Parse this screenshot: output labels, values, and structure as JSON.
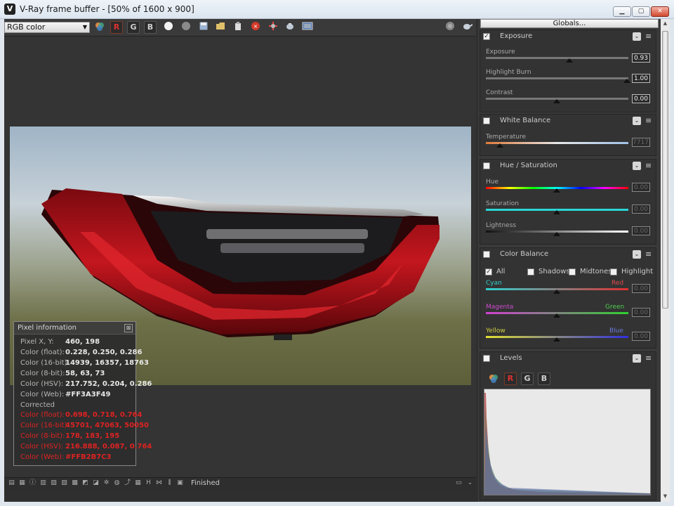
{
  "window": {
    "title": "V-Ray frame buffer - [50% of 1600 x 900]",
    "app_icon": "V",
    "minimize_icon": "minimize-icon",
    "maximize_icon": "maximize-icon",
    "close_icon": "close-icon"
  },
  "toolbar": {
    "channel": "RGB color",
    "r_label": "R",
    "g_label": "G",
    "b_label": "B",
    "icons": [
      "color-corrections-icon",
      "white-dot-icon",
      "gray-dot-icon",
      "save-icon",
      "open-icon",
      "clear-icon",
      "stop-icon",
      "region-icon",
      "teapot-icon",
      "camera-icon",
      "render-icon",
      "teapot-right-icon"
    ]
  },
  "pixel_info": {
    "title": "Pixel information",
    "rows": [
      {
        "label": "Pixel X, Y:",
        "value": "460, 198"
      },
      {
        "label": "Color (float):",
        "value": "0.228, 0.250, 0.286"
      },
      {
        "label": "Color (16-bit):",
        "value": "14939, 16357, 18763"
      },
      {
        "label": "Color (8-bit):",
        "value": "58, 63, 73"
      },
      {
        "label": "Color (HSV):",
        "value": "217.752, 0.204, 0.286"
      },
      {
        "label": "Color (Web):",
        "value": "#FF3A3F49"
      }
    ],
    "corrected_label": "Corrected",
    "corrected_rows": [
      {
        "label": "Color (float):",
        "value": "0.698, 0.718, 0.764"
      },
      {
        "label": "Color (16-bit):",
        "value": "45701, 47063, 50050"
      },
      {
        "label": "Color (8-bit):",
        "value": "178, 183, 195"
      },
      {
        "label": "Color (HSV):",
        "value": "216.888, 0.087, 0.764"
      },
      {
        "label": "Color (Web):",
        "value": "#FFB2B7C3"
      }
    ]
  },
  "status": {
    "text": "Finished"
  },
  "right_panel": {
    "globals_label": "Globals...",
    "exposure": {
      "title": "Exposure",
      "checked": true,
      "sliders": [
        {
          "label": "Exposure",
          "value": "0.93",
          "pos": 0.6
        },
        {
          "label": "Highlight Burn",
          "value": "1.00",
          "pos": 1.0
        },
        {
          "label": "Contrast",
          "value": "0.00",
          "pos": 0.5
        }
      ]
    },
    "white_balance": {
      "title": "White Balance",
      "checked": false,
      "label": "Temperature",
      "value": "7717",
      "pos": 0.1
    },
    "hue_saturation": {
      "title": "Hue / Saturation",
      "checked": false,
      "sliders": [
        {
          "label": "Hue",
          "value": "0.00",
          "pos": 0.5
        },
        {
          "label": "Saturation",
          "value": "0.00",
          "pos": 0.5
        },
        {
          "label": "Lightness",
          "value": "0.00",
          "pos": 0.5
        }
      ]
    },
    "color_balance": {
      "title": "Color Balance",
      "checked": false,
      "options": {
        "all": "All",
        "shadows": "Shadows",
        "midtones": "Midtones",
        "highlight": "Highlight"
      },
      "sliders": [
        {
          "left": "Cyan",
          "right": "Red",
          "value": "0.00",
          "pos": 0.5
        },
        {
          "left": "Magenta",
          "right": "Green",
          "value": "0.00",
          "pos": 0.5
        },
        {
          "left": "Yellow",
          "right": "Blue",
          "value": "0.00",
          "pos": 0.5
        }
      ]
    },
    "levels": {
      "title": "Levels",
      "checked": false,
      "r_label": "R",
      "g_label": "G",
      "b_label": "B"
    }
  },
  "colors": {
    "accent_red": "#e52222",
    "panel_bg": "#333333",
    "tail_light_red": "#b0121a"
  }
}
